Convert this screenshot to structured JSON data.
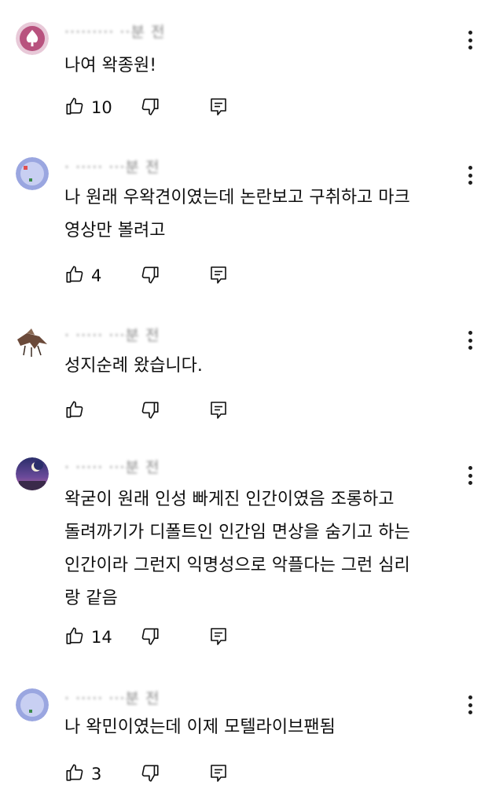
{
  "comments": [
    {
      "author_meta": "·········  ··분 전",
      "text_lines": [
        "나여 왁종원!"
      ],
      "likes": "10"
    },
    {
      "author_meta": "· ·····  ···분 전",
      "text_lines": [
        "나 원래 우왁견이였는데 논란보고 구취하고 마크",
        "영상만 볼려고"
      ],
      "likes": "4"
    },
    {
      "author_meta": "· ·····  ···분 전",
      "text_lines": [
        "성지순례 왔습니다."
      ],
      "likes": ""
    },
    {
      "author_meta": "· ·····  ···분 전",
      "text_lines": [
        "왁굳이 원래 인성 빠게진 인간이였음 조롱하고",
        "돌려까기가 디폴트인 인간임 면상을 숨기고 하는",
        "인간이라 그런지 익명성으로 악플다는 그런 심리",
        "랑 같음"
      ],
      "likes": "14"
    },
    {
      "author_meta": "· ·····  ···분 전",
      "text_lines": [
        "나 왁민이였는데 이제 모텔라이브팬됨"
      ],
      "likes": "3"
    }
  ],
  "icons": {
    "like": "thumbs-up-icon",
    "dislike": "thumbs-down-icon",
    "reply": "reply-comment-icon",
    "more": "more-vertical-icon"
  }
}
